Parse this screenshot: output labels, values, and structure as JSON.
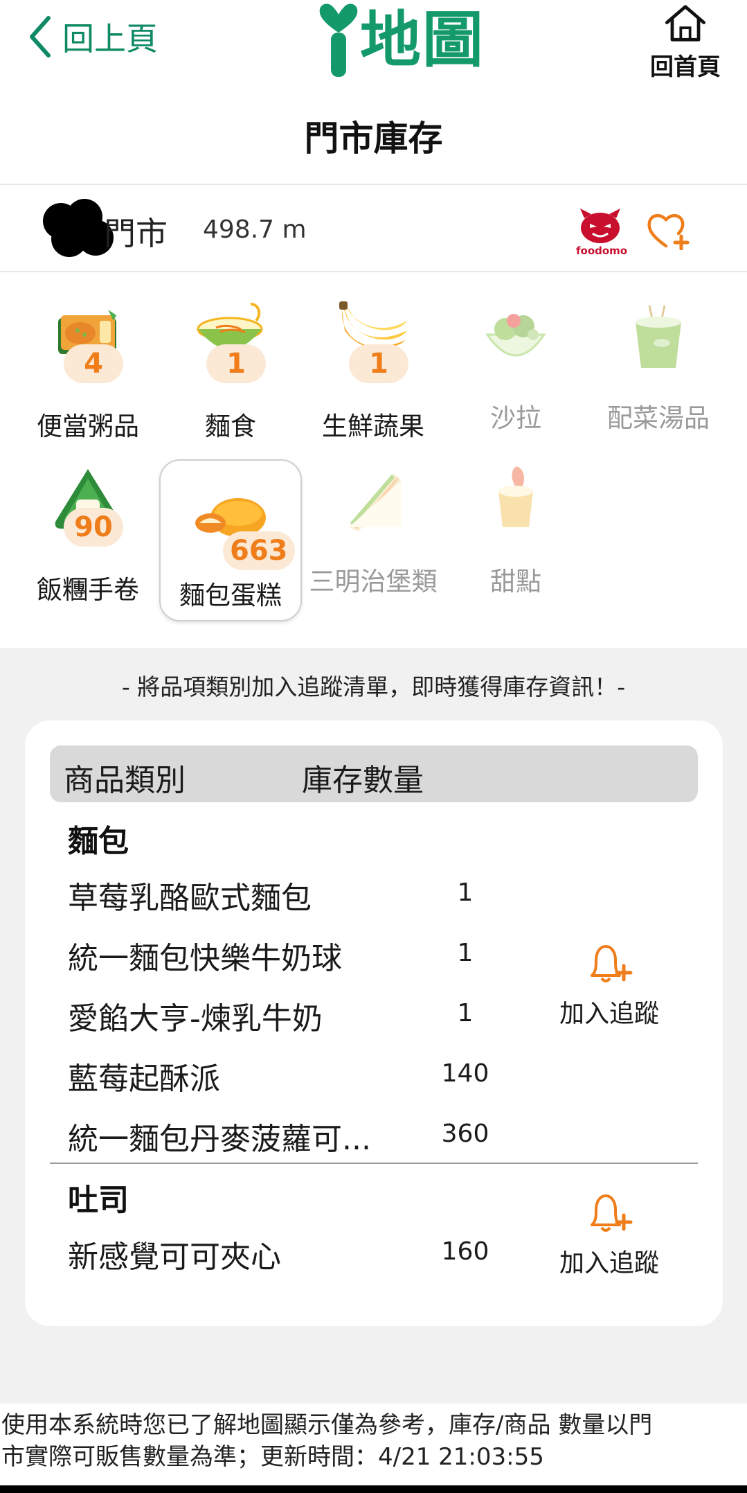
{
  "header": {
    "back_label": "回上頁",
    "logo_text": "地圖",
    "home_label": "回首頁",
    "page_title": "門市庫存"
  },
  "store": {
    "name": "門市",
    "distance": "498.7 m",
    "foodomo_label": "foodomo"
  },
  "categories": [
    {
      "label": "便當粥品",
      "count": "4",
      "icon": "bento-icon",
      "enabled": true
    },
    {
      "label": "麵食",
      "count": "1",
      "icon": "noodle-bowl-icon",
      "enabled": true
    },
    {
      "label": "生鮮蔬果",
      "count": "1",
      "icon": "banana-icon",
      "enabled": true
    },
    {
      "label": "沙拉",
      "count": null,
      "icon": "salad-icon",
      "enabled": false
    },
    {
      "label": "配菜湯品",
      "count": null,
      "icon": "soup-cup-icon",
      "enabled": false
    },
    {
      "label": "飯糰手卷",
      "count": "90",
      "icon": "onigiri-icon",
      "enabled": true
    },
    {
      "label": "麵包蛋糕",
      "count": "663",
      "icon": "bread-icon",
      "enabled": true,
      "selected": true
    },
    {
      "label": "三明治堡類",
      "count": null,
      "icon": "sandwich-icon",
      "enabled": false
    },
    {
      "label": "甜點",
      "count": null,
      "icon": "pudding-icon",
      "enabled": false
    }
  ],
  "hint": "- 將品項類別加入追蹤清單，即時獲得庫存資訊！-",
  "table": {
    "col_category": "商品類別",
    "col_stock": "庫存數量",
    "groups": [
      {
        "title": "麵包",
        "track_label": "加入追蹤",
        "items": [
          {
            "name": "草莓乳酪歐式麵包",
            "qty": "1"
          },
          {
            "name": "統一麵包快樂牛奶球",
            "qty": "1"
          },
          {
            "name": "愛餡大亨-煉乳牛奶",
            "qty": "1"
          },
          {
            "name": "藍莓起酥派",
            "qty": "140"
          },
          {
            "name": "統一麵包丹麥菠蘿可...",
            "qty": "360"
          }
        ]
      },
      {
        "title": "吐司",
        "track_label": "加入追蹤",
        "items": [
          {
            "name": "新感覺可可夾心",
            "qty": "160"
          }
        ]
      }
    ]
  },
  "footer": {
    "line1": "使用本系統時您已了解地圖顯示僅為參考，庫存/商品 數量以門",
    "line2": "市實際可販售數量為準；更新時間：4/21 21:03:55"
  },
  "colors": {
    "brand_green": "#149a6a",
    "accent_orange": "#ef7d1a",
    "badge_bg": "#fbe9d6"
  }
}
